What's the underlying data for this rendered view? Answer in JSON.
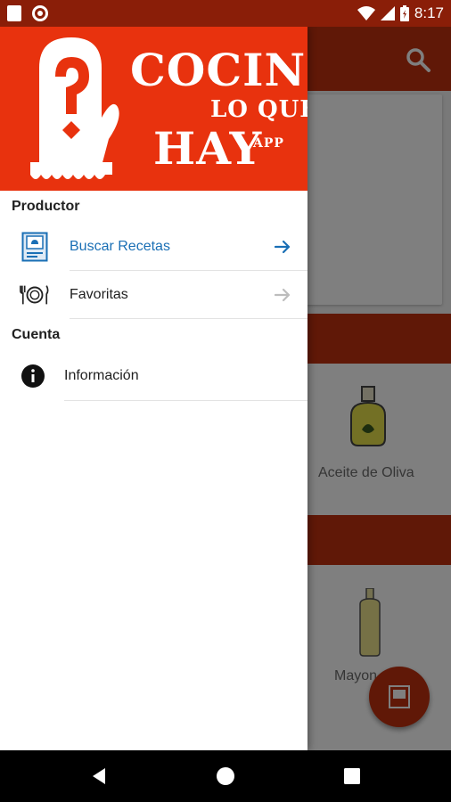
{
  "status_bar": {
    "time": "8:17"
  },
  "drawer": {
    "logo": {
      "line1": "COCINO",
      "line2": "LO QUE",
      "line3": "HAY",
      "line4": "APP"
    },
    "sections": [
      {
        "title": "Productor",
        "items": [
          {
            "label": "Buscar Recetas",
            "icon": "recipe-book-icon",
            "active": true
          },
          {
            "label": "Favoritas",
            "icon": "plate-cutlery-icon",
            "active": false
          }
        ]
      },
      {
        "title": "Cuenta",
        "items": [
          {
            "label": "Información",
            "icon": "info-icon"
          }
        ]
      }
    ]
  },
  "background": {
    "card_labels": [
      "Aceite de Oliva",
      "Mayon"
    ]
  },
  "colors": {
    "brand": "#e8320e",
    "toolbar": "#c1300f",
    "status_bar": "#8a1e08",
    "active_text": "#1a6fb5"
  }
}
